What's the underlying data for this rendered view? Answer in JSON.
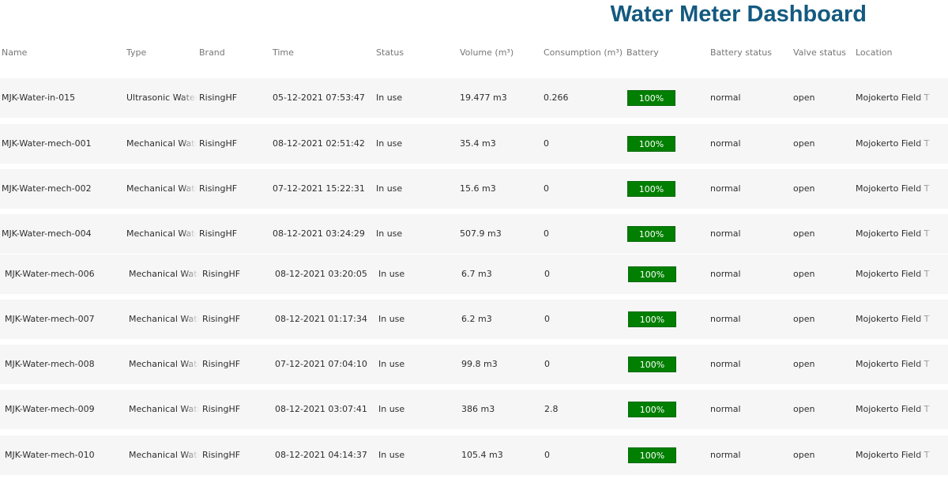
{
  "page_title": "Water Meter Dashboard",
  "columns": {
    "name": "Name",
    "type": "Type",
    "brand": "Brand",
    "time": "Time",
    "status": "Status",
    "volume": "Volume (m³)",
    "consumption": "Consumption (m³)",
    "battery": "Battery",
    "battery_status": "Battery status",
    "valve_status": "Valve status",
    "location": "Location"
  },
  "colors": {
    "title": "#145a80",
    "battery_fill": "#007f00",
    "row_background": "#f6f6f6"
  },
  "rows": [
    {
      "name": "MJK-Water-in-015",
      "type": "Ultrasonic Water Meter",
      "brand": "RisingHF",
      "time": "05-12-2021 07:53:47",
      "status": "In use",
      "volume": "19.477 m3",
      "consumption": "0.266",
      "battery": "100%",
      "battery_level": 1.0,
      "battery_status": "normal",
      "valve_status": "open",
      "location": "Mojokerto Field T"
    },
    {
      "name": "MJK-Water-mech-001",
      "type": "Mechanical Water Meter",
      "brand": "RisingHF",
      "time": "08-12-2021 02:51:42",
      "status": "In use",
      "volume": "35.4 m3",
      "consumption": "0",
      "battery": "100%",
      "battery_level": 1.0,
      "battery_status": "normal",
      "valve_status": "open",
      "location": "Mojokerto Field T"
    },
    {
      "name": "MJK-Water-mech-002",
      "type": "Mechanical Water Meter",
      "brand": "RisingHF",
      "time": "07-12-2021 15:22:31",
      "status": "In use",
      "volume": "15.6 m3",
      "consumption": "0",
      "battery": "100%",
      "battery_level": 1.0,
      "battery_status": "normal",
      "valve_status": "open",
      "location": "Mojokerto Field T"
    },
    {
      "name": "MJK-Water-mech-004",
      "type": "Mechanical Water Meter",
      "brand": "RisingHF",
      "time": "08-12-2021 03:24:29",
      "status": "In use",
      "volume": "507.9 m3",
      "consumption": "0",
      "battery": "100%",
      "battery_level": 1.0,
      "battery_status": "normal",
      "valve_status": "open",
      "location": "Mojokerto Field T"
    },
    {
      "name": "MJK-Water-mech-006",
      "type": "Mechanical Water Meter",
      "brand": "RisingHF",
      "time": "08-12-2021 03:20:05",
      "status": "In use",
      "volume": "6.7 m3",
      "consumption": "0",
      "battery": "100%",
      "battery_level": 1.0,
      "battery_status": "normal",
      "valve_status": "open",
      "location": "Mojokerto Field T"
    },
    {
      "name": "MJK-Water-mech-007",
      "type": "Mechanical Water Meter",
      "brand": "RisingHF",
      "time": "08-12-2021 01:17:34",
      "status": "In use",
      "volume": "6.2 m3",
      "consumption": "0",
      "battery": "100%",
      "battery_level": 1.0,
      "battery_status": "normal",
      "valve_status": "open",
      "location": "Mojokerto Field T"
    },
    {
      "name": "MJK-Water-mech-008",
      "type": "Mechanical Water Meter",
      "brand": "RisingHF",
      "time": "07-12-2021 07:04:10",
      "status": "In use",
      "volume": "99.8 m3",
      "consumption": "0",
      "battery": "100%",
      "battery_level": 1.0,
      "battery_status": "normal",
      "valve_status": "open",
      "location": "Mojokerto Field T"
    },
    {
      "name": "MJK-Water-mech-009",
      "type": "Mechanical Water Meter",
      "brand": "RisingHF",
      "time": "08-12-2021 03:07:41",
      "status": "In use",
      "volume": "386 m3",
      "consumption": "2.8",
      "battery": "100%",
      "battery_level": 1.0,
      "battery_status": "normal",
      "valve_status": "open",
      "location": "Mojokerto Field T"
    },
    {
      "name": "MJK-Water-mech-010",
      "type": "Mechanical Water Meter",
      "brand": "RisingHF",
      "time": "08-12-2021 04:14:37",
      "status": "In use",
      "volume": "105.4 m3",
      "consumption": "0",
      "battery": "100%",
      "battery_level": 1.0,
      "battery_status": "normal",
      "valve_status": "open",
      "location": "Mojokerto Field T"
    }
  ]
}
